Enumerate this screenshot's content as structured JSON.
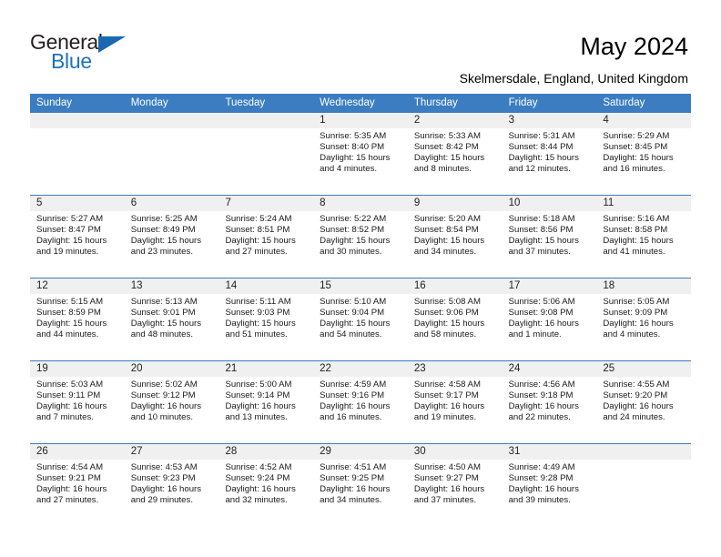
{
  "brand": {
    "name_top": "General",
    "name_bottom": "Blue",
    "accent_color": "#1a69b0"
  },
  "header": {
    "title": "May 2024",
    "subtitle": "Skelmersdale, England, United Kingdom"
  },
  "calendar": {
    "header_bg": "#3b7dc0",
    "weekdays": [
      "Sunday",
      "Monday",
      "Tuesday",
      "Wednesday",
      "Thursday",
      "Friday",
      "Saturday"
    ],
    "weeks": [
      [
        {
          "date": "",
          "empty": true,
          "sunrise": "",
          "sunset": "",
          "daylight": "",
          "daylight2": ""
        },
        {
          "date": "",
          "empty": true,
          "sunrise": "",
          "sunset": "",
          "daylight": "",
          "daylight2": ""
        },
        {
          "date": "",
          "empty": true,
          "sunrise": "",
          "sunset": "",
          "daylight": "",
          "daylight2": ""
        },
        {
          "date": "1",
          "empty": false,
          "sunrise": "Sunrise: 5:35 AM",
          "sunset": "Sunset: 8:40 PM",
          "daylight": "Daylight: 15 hours",
          "daylight2": "and 4 minutes."
        },
        {
          "date": "2",
          "empty": false,
          "sunrise": "Sunrise: 5:33 AM",
          "sunset": "Sunset: 8:42 PM",
          "daylight": "Daylight: 15 hours",
          "daylight2": "and 8 minutes."
        },
        {
          "date": "3",
          "empty": false,
          "sunrise": "Sunrise: 5:31 AM",
          "sunset": "Sunset: 8:44 PM",
          "daylight": "Daylight: 15 hours",
          "daylight2": "and 12 minutes."
        },
        {
          "date": "4",
          "empty": false,
          "sunrise": "Sunrise: 5:29 AM",
          "sunset": "Sunset: 8:45 PM",
          "daylight": "Daylight: 15 hours",
          "daylight2": "and 16 minutes."
        }
      ],
      [
        {
          "date": "5",
          "empty": false,
          "sunrise": "Sunrise: 5:27 AM",
          "sunset": "Sunset: 8:47 PM",
          "daylight": "Daylight: 15 hours",
          "daylight2": "and 19 minutes."
        },
        {
          "date": "6",
          "empty": false,
          "sunrise": "Sunrise: 5:25 AM",
          "sunset": "Sunset: 8:49 PM",
          "daylight": "Daylight: 15 hours",
          "daylight2": "and 23 minutes."
        },
        {
          "date": "7",
          "empty": false,
          "sunrise": "Sunrise: 5:24 AM",
          "sunset": "Sunset: 8:51 PM",
          "daylight": "Daylight: 15 hours",
          "daylight2": "and 27 minutes."
        },
        {
          "date": "8",
          "empty": false,
          "sunrise": "Sunrise: 5:22 AM",
          "sunset": "Sunset: 8:52 PM",
          "daylight": "Daylight: 15 hours",
          "daylight2": "and 30 minutes."
        },
        {
          "date": "9",
          "empty": false,
          "sunrise": "Sunrise: 5:20 AM",
          "sunset": "Sunset: 8:54 PM",
          "daylight": "Daylight: 15 hours",
          "daylight2": "and 34 minutes."
        },
        {
          "date": "10",
          "empty": false,
          "sunrise": "Sunrise: 5:18 AM",
          "sunset": "Sunset: 8:56 PM",
          "daylight": "Daylight: 15 hours",
          "daylight2": "and 37 minutes."
        },
        {
          "date": "11",
          "empty": false,
          "sunrise": "Sunrise: 5:16 AM",
          "sunset": "Sunset: 8:58 PM",
          "daylight": "Daylight: 15 hours",
          "daylight2": "and 41 minutes."
        }
      ],
      [
        {
          "date": "12",
          "empty": false,
          "sunrise": "Sunrise: 5:15 AM",
          "sunset": "Sunset: 8:59 PM",
          "daylight": "Daylight: 15 hours",
          "daylight2": "and 44 minutes."
        },
        {
          "date": "13",
          "empty": false,
          "sunrise": "Sunrise: 5:13 AM",
          "sunset": "Sunset: 9:01 PM",
          "daylight": "Daylight: 15 hours",
          "daylight2": "and 48 minutes."
        },
        {
          "date": "14",
          "empty": false,
          "sunrise": "Sunrise: 5:11 AM",
          "sunset": "Sunset: 9:03 PM",
          "daylight": "Daylight: 15 hours",
          "daylight2": "and 51 minutes."
        },
        {
          "date": "15",
          "empty": false,
          "sunrise": "Sunrise: 5:10 AM",
          "sunset": "Sunset: 9:04 PM",
          "daylight": "Daylight: 15 hours",
          "daylight2": "and 54 minutes."
        },
        {
          "date": "16",
          "empty": false,
          "sunrise": "Sunrise: 5:08 AM",
          "sunset": "Sunset: 9:06 PM",
          "daylight": "Daylight: 15 hours",
          "daylight2": "and 58 minutes."
        },
        {
          "date": "17",
          "empty": false,
          "sunrise": "Sunrise: 5:06 AM",
          "sunset": "Sunset: 9:08 PM",
          "daylight": "Daylight: 16 hours",
          "daylight2": "and 1 minute."
        },
        {
          "date": "18",
          "empty": false,
          "sunrise": "Sunrise: 5:05 AM",
          "sunset": "Sunset: 9:09 PM",
          "daylight": "Daylight: 16 hours",
          "daylight2": "and 4 minutes."
        }
      ],
      [
        {
          "date": "19",
          "empty": false,
          "sunrise": "Sunrise: 5:03 AM",
          "sunset": "Sunset: 9:11 PM",
          "daylight": "Daylight: 16 hours",
          "daylight2": "and 7 minutes."
        },
        {
          "date": "20",
          "empty": false,
          "sunrise": "Sunrise: 5:02 AM",
          "sunset": "Sunset: 9:12 PM",
          "daylight": "Daylight: 16 hours",
          "daylight2": "and 10 minutes."
        },
        {
          "date": "21",
          "empty": false,
          "sunrise": "Sunrise: 5:00 AM",
          "sunset": "Sunset: 9:14 PM",
          "daylight": "Daylight: 16 hours",
          "daylight2": "and 13 minutes."
        },
        {
          "date": "22",
          "empty": false,
          "sunrise": "Sunrise: 4:59 AM",
          "sunset": "Sunset: 9:16 PM",
          "daylight": "Daylight: 16 hours",
          "daylight2": "and 16 minutes."
        },
        {
          "date": "23",
          "empty": false,
          "sunrise": "Sunrise: 4:58 AM",
          "sunset": "Sunset: 9:17 PM",
          "daylight": "Daylight: 16 hours",
          "daylight2": "and 19 minutes."
        },
        {
          "date": "24",
          "empty": false,
          "sunrise": "Sunrise: 4:56 AM",
          "sunset": "Sunset: 9:18 PM",
          "daylight": "Daylight: 16 hours",
          "daylight2": "and 22 minutes."
        },
        {
          "date": "25",
          "empty": false,
          "sunrise": "Sunrise: 4:55 AM",
          "sunset": "Sunset: 9:20 PM",
          "daylight": "Daylight: 16 hours",
          "daylight2": "and 24 minutes."
        }
      ],
      [
        {
          "date": "26",
          "empty": false,
          "sunrise": "Sunrise: 4:54 AM",
          "sunset": "Sunset: 9:21 PM",
          "daylight": "Daylight: 16 hours",
          "daylight2": "and 27 minutes."
        },
        {
          "date": "27",
          "empty": false,
          "sunrise": "Sunrise: 4:53 AM",
          "sunset": "Sunset: 9:23 PM",
          "daylight": "Daylight: 16 hours",
          "daylight2": "and 29 minutes."
        },
        {
          "date": "28",
          "empty": false,
          "sunrise": "Sunrise: 4:52 AM",
          "sunset": "Sunset: 9:24 PM",
          "daylight": "Daylight: 16 hours",
          "daylight2": "and 32 minutes."
        },
        {
          "date": "29",
          "empty": false,
          "sunrise": "Sunrise: 4:51 AM",
          "sunset": "Sunset: 9:25 PM",
          "daylight": "Daylight: 16 hours",
          "daylight2": "and 34 minutes."
        },
        {
          "date": "30",
          "empty": false,
          "sunrise": "Sunrise: 4:50 AM",
          "sunset": "Sunset: 9:27 PM",
          "daylight": "Daylight: 16 hours",
          "daylight2": "and 37 minutes."
        },
        {
          "date": "31",
          "empty": false,
          "sunrise": "Sunrise: 4:49 AM",
          "sunset": "Sunset: 9:28 PM",
          "daylight": "Daylight: 16 hours",
          "daylight2": "and 39 minutes."
        },
        {
          "date": "",
          "empty": true,
          "sunrise": "",
          "sunset": "",
          "daylight": "",
          "daylight2": ""
        }
      ]
    ]
  }
}
